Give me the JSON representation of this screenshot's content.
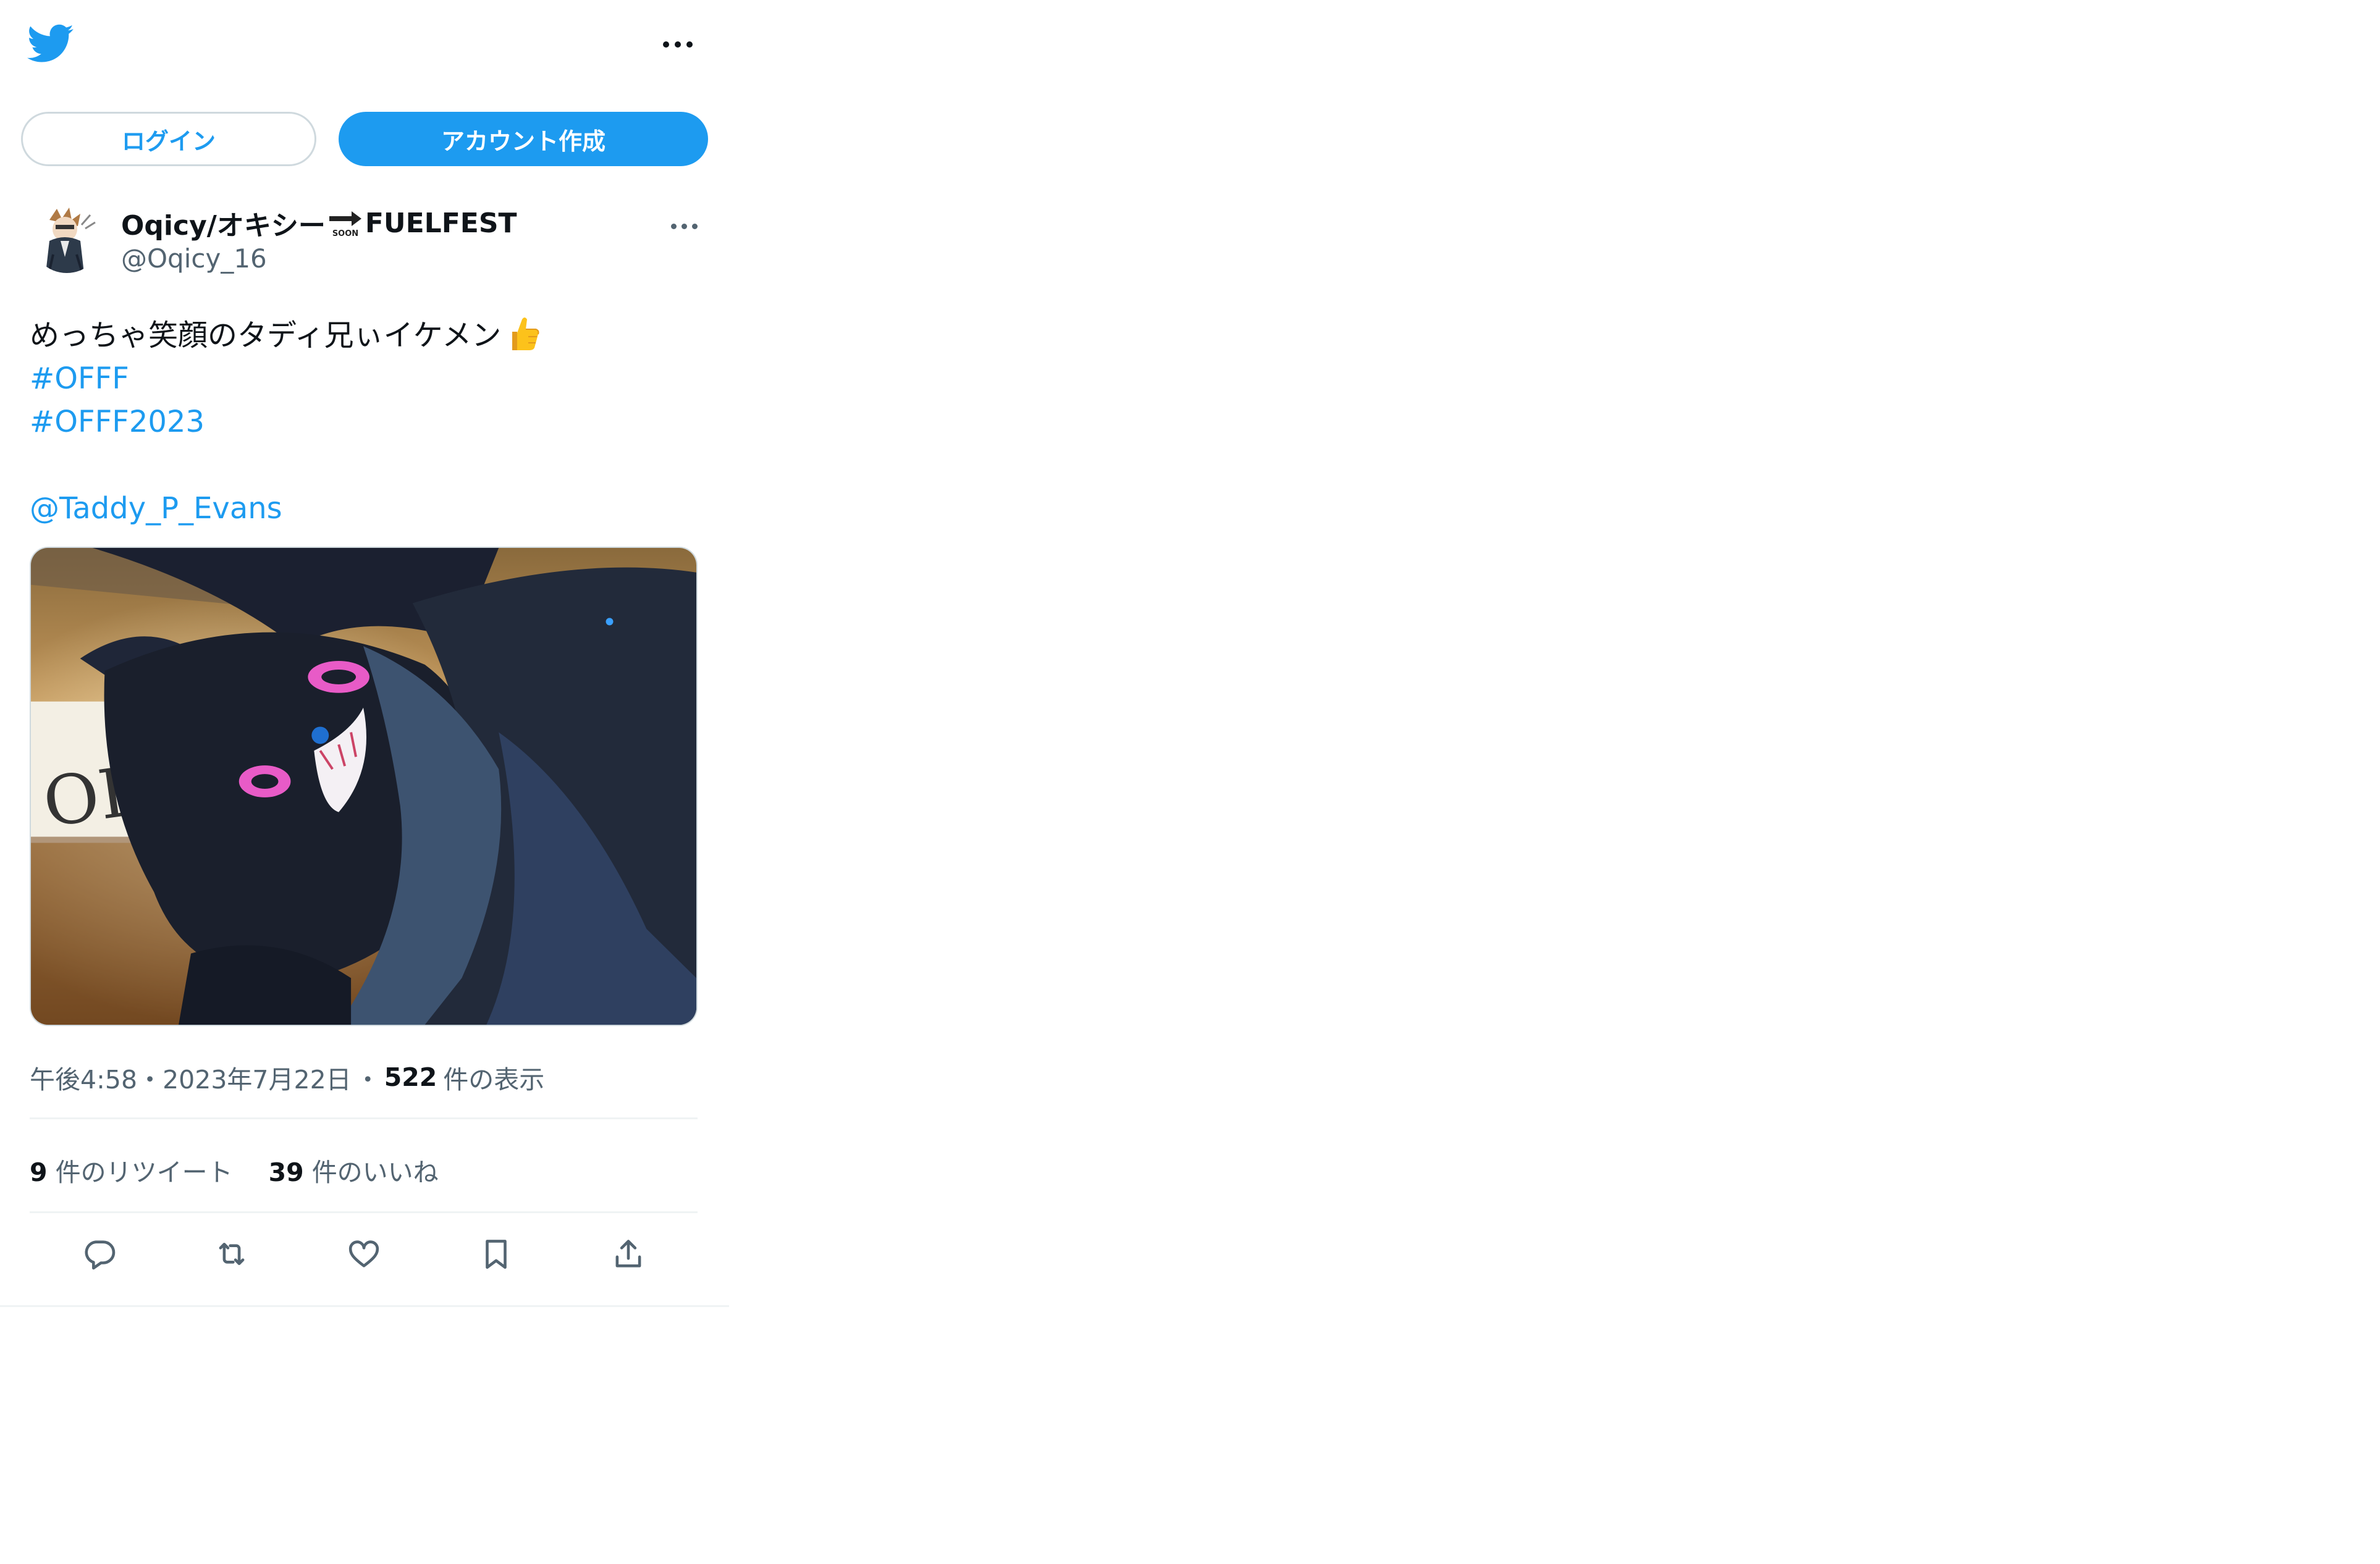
{
  "header": {
    "logo": "twitter-bird-icon",
    "more_icon": "more-horizontal-icon"
  },
  "auth": {
    "login_label": "ログイン",
    "signup_label": "アカウント作成"
  },
  "tweet": {
    "author": {
      "display_name_part1": "Oqicy/オキシー",
      "display_name_emoji": "soon-arrow-emoji",
      "display_name_part2": "FUELFEST",
      "handle": "@Oqicy_16"
    },
    "text_line1": "めっちゃ笑顔のタディ兄ぃイケメン",
    "text_emoji": "thumbs-up-emoji",
    "hashtag1": "#OFFF",
    "hashtag2": "#OFFF2023",
    "mention": "@Taddy_P_Evans",
    "media_description_icon": "photo-fursuit",
    "time": "午後4:58",
    "date_separator": "・",
    "date": "2023年7月22日",
    "views_separator": "・",
    "views_count": "522",
    "views_label": "件の表示",
    "retweets_count": "9",
    "retweets_label": "件のリツイート",
    "likes_count": "39",
    "likes_label": "件のいいね"
  },
  "actions": {
    "reply_icon": "reply-icon",
    "retweet_icon": "retweet-icon",
    "like_icon": "heart-icon",
    "bookmark_icon": "bookmark-icon",
    "share_icon": "share-icon"
  },
  "colors": {
    "accent": "#1d9bf0",
    "text": "#0f1419",
    "secondary": "#536471",
    "divider": "#eff3f4"
  }
}
